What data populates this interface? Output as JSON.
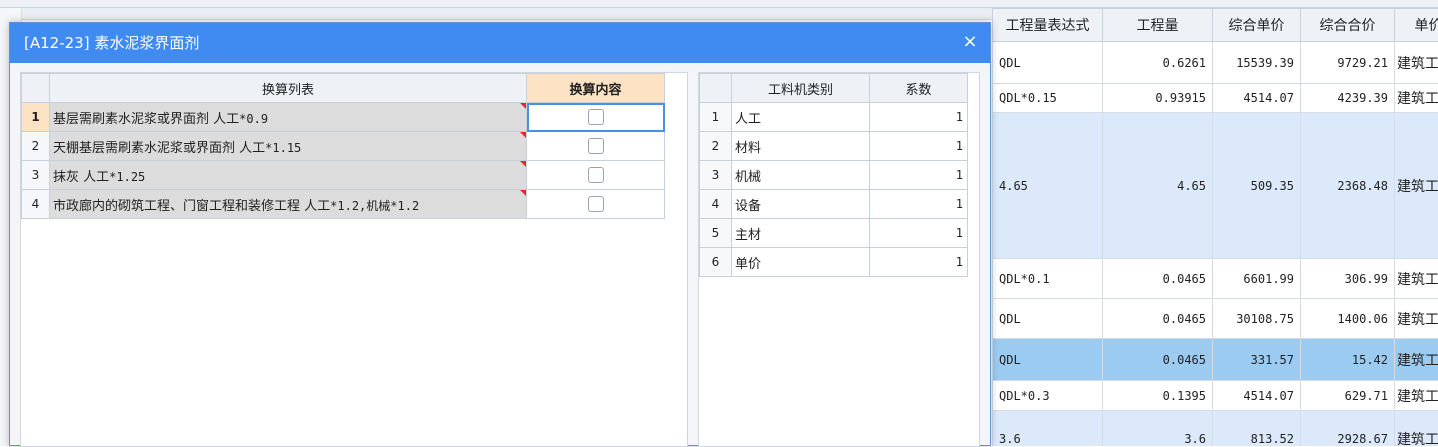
{
  "background": {
    "right_grid": {
      "headers": [
        "工程量表达式",
        "工程量",
        "综合单价",
        "综合合价",
        "单价"
      ],
      "rows": [
        {
          "expr": "QDL",
          "qty": "0.6261",
          "unit_price": "15539.39",
          "total": "9729.21",
          "unit": "建筑工"
        },
        {
          "expr": "QDL*0.15",
          "qty": "0.93915",
          "unit_price": "4514.07",
          "total": "4239.39",
          "unit": "建筑工"
        },
        {
          "expr": "4.65",
          "qty": "4.65",
          "unit_price": "509.35",
          "total": "2368.48",
          "unit": "建筑工"
        },
        {
          "expr": "QDL*0.1",
          "qty": "0.0465",
          "unit_price": "6601.99",
          "total": "306.99",
          "unit": "建筑工"
        },
        {
          "expr": "QDL",
          "qty": "0.0465",
          "unit_price": "30108.75",
          "total": "1400.06",
          "unit": "建筑工"
        },
        {
          "expr": "QDL",
          "qty": "0.0465",
          "unit_price": "331.57",
          "total": "15.42",
          "unit": "建筑工"
        },
        {
          "expr": "QDL*0.3",
          "qty": "0.1395",
          "unit_price": "4514.07",
          "total": "629.71",
          "unit": "建筑工"
        },
        {
          "expr": "3.6",
          "qty": "3.6",
          "unit_price": "813.52",
          "total": "2928.67",
          "unit": "建筑工"
        }
      ]
    }
  },
  "dialog": {
    "title": "[A12-23] 素水泥浆界面剂",
    "close_glyph": "×",
    "conversion_table": {
      "headers": {
        "list": "换算列表",
        "content": "换算内容"
      },
      "rows": [
        {
          "index": "1",
          "text": "基层需刷素水泥浆或界面剂 人工",
          "factor": "*0.9",
          "checked": false
        },
        {
          "index": "2",
          "text": "天棚基层需刷素水泥浆或界面剂 人工",
          "factor": "*1.15",
          "checked": false
        },
        {
          "index": "3",
          "text": "抹灰 人工",
          "factor": "*1.25",
          "checked": false
        },
        {
          "index": "4",
          "text": "市政廊内的砌筑工程、门窗工程和装修工程 人工",
          "factor": "*1.2,机械*1.2",
          "checked": false
        }
      ]
    },
    "category_table": {
      "headers": {
        "category": "工料机类别",
        "coef": "系数"
      },
      "rows": [
        {
          "index": "1",
          "category": "人工",
          "coef": "1"
        },
        {
          "index": "2",
          "category": "材料",
          "coef": "1"
        },
        {
          "index": "3",
          "category": "机械",
          "coef": "1"
        },
        {
          "index": "4",
          "category": "设备",
          "coef": "1"
        },
        {
          "index": "5",
          "category": "主材",
          "coef": "1"
        },
        {
          "index": "6",
          "category": "单价",
          "coef": "1"
        }
      ]
    }
  }
}
